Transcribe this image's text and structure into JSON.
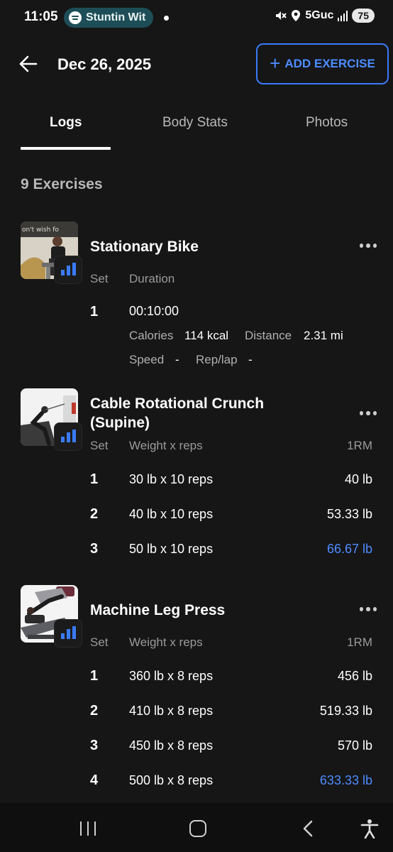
{
  "status_bar": {
    "time": "11:05",
    "media_pill": "Stuntin Wit",
    "network": "5Guc",
    "battery": "75"
  },
  "header": {
    "date": "Dec 26, 2025",
    "add_exercise_label": "ADD EXERCISE"
  },
  "tabs": [
    {
      "label": "Logs",
      "active": true
    },
    {
      "label": "Body Stats",
      "active": false
    },
    {
      "label": "Photos",
      "active": false
    }
  ],
  "exercise_count": "9 Exercises",
  "exercises": [
    {
      "name": "Stationary Bike",
      "col_set": "Set",
      "col_value": "Duration",
      "sets": [
        {
          "num": "1",
          "duration": "00:10:00",
          "calories_label": "Calories",
          "calories": "114 kcal",
          "distance_label": "Distance",
          "distance": "2.31 mi",
          "speed_label": "Speed",
          "speed": "-",
          "replap_label": "Rep/lap",
          "replap": "-"
        }
      ]
    },
    {
      "name_line1": "Cable Rotational Crunch",
      "name_line2": "(Supine)",
      "col_set": "Set",
      "col_value": "Weight x reps",
      "col_1rm": "1RM",
      "sets": [
        {
          "num": "1",
          "value": "30 lb x 10 reps",
          "one_rm": "40 lb",
          "pr": false
        },
        {
          "num": "2",
          "value": "40 lb x 10 reps",
          "one_rm": "53.33 lb",
          "pr": false
        },
        {
          "num": "3",
          "value": "50 lb x 10 reps",
          "one_rm": "66.67 lb",
          "pr": true
        }
      ]
    },
    {
      "name": "Machine Leg Press",
      "col_set": "Set",
      "col_value": "Weight x reps",
      "col_1rm": "1RM",
      "sets": [
        {
          "num": "1",
          "value": "360 lb x 8 reps",
          "one_rm": "456 lb",
          "pr": false
        },
        {
          "num": "2",
          "value": "410 lb x 8 reps",
          "one_rm": "519.33 lb",
          "pr": false
        },
        {
          "num": "3",
          "value": "450 lb x 8 reps",
          "one_rm": "570 lb",
          "pr": false
        },
        {
          "num": "4",
          "value": "500 lb x 8 reps",
          "one_rm": "633.33 lb",
          "pr": true
        }
      ]
    }
  ],
  "colors": {
    "background": "#161616",
    "accent": "#3a7bf6",
    "pr_text": "#4d8cff",
    "muted": "#9a9a9a",
    "pill": "#1d4e57"
  },
  "icons": [
    "spotify-icon",
    "mute-icon",
    "location-icon",
    "signal-icon",
    "back-arrow-icon",
    "plus-icon",
    "bar-chart-icon",
    "more-options-icon",
    "recent-apps-icon",
    "home-icon",
    "nav-back-icon",
    "accessibility-icon"
  ]
}
